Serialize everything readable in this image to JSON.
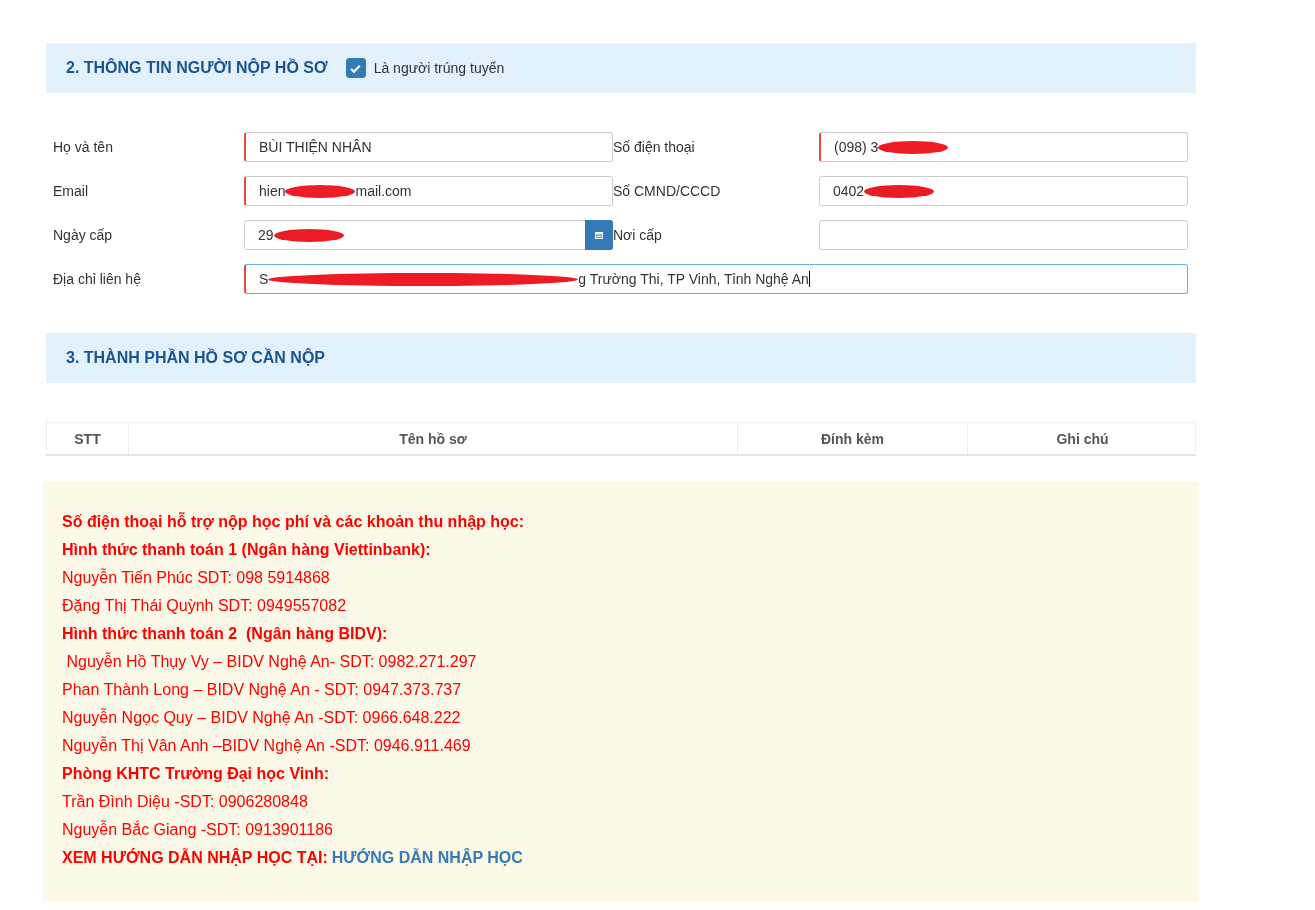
{
  "applicant_section": {
    "title": "2. THÔNG TIN NGƯỜI NỘP HỒ SƠ",
    "checkbox": {
      "label": "Là người trúng tuyển",
      "checked": true
    }
  },
  "fields": [
    {
      "label": "Họ và tên",
      "before": "BÙI THIỆN NHÂN",
      "redacted": false,
      "required": true,
      "focused": false,
      "kind": "text"
    },
    {
      "label": "Số điện thoại",
      "before": "(098) 3",
      "redacted": true,
      "required": true,
      "focused": false,
      "kind": "text"
    },
    {
      "label": "Email",
      "before": "hien",
      "redacted": true,
      "after": "mail.com",
      "required": true,
      "focused": false,
      "kind": "text"
    },
    {
      "label": "Số CMND/CCCD",
      "before": "0402",
      "redacted": true,
      "required": false,
      "focused": false,
      "kind": "text"
    },
    {
      "label": "Ngày cấp",
      "before": "29",
      "redacted": true,
      "required": false,
      "focused": false,
      "kind": "date"
    },
    {
      "label": "Nơi cấp",
      "redacted": false,
      "required": false,
      "focused": false,
      "kind": "text"
    },
    {
      "label": "Địa chỉ liên hệ",
      "before": "S",
      "redacted": true,
      "after": "g Trường Thi, TP Vinh, Tỉnh Nghệ An",
      "required": true,
      "focused": true,
      "kind": "wide"
    }
  ],
  "documents_section": {
    "title": "3. THÀNH PHẦN HỒ SƠ CẦN NỘP"
  },
  "table": {
    "columns": [
      "STT",
      "Tên hồ sơ",
      "Đính kèm",
      "Ghi chú"
    ]
  },
  "notice": [
    {
      "kind": "heading",
      "text": "Số điện thoại hỗ trợ nộp học phí và các khoản thu nhập học:"
    },
    {
      "kind": "heading",
      "text": "Hình thức thanh toán 1 (Ngân hàng Viettinbank):"
    },
    {
      "kind": "plain",
      "text": "Nguyễn Tiến Phúc SDT: 098 5914868"
    },
    {
      "kind": "plain",
      "text": "Đặng Thị Thái Quỳnh SDT: 0949557082"
    },
    {
      "kind": "heading",
      "text": "Hình thức thanh toán 2  (Ngân hàng BIDV):"
    },
    {
      "kind": "plain",
      "text": " Nguyễn Hồ Thụy Vy – BIDV Nghệ An- SDT: 0982.271.297"
    },
    {
      "kind": "plain",
      "text": "Phan Thành Long – BIDV Nghệ An - SDT: 0947.373.737"
    },
    {
      "kind": "plain",
      "text": "Nguyễn Ngọc Quy – BIDV Nghệ An -SDT: 0966.648.222"
    },
    {
      "kind": "plain",
      "text": "Nguyễn Thị Vân Anh –BIDV Nghệ An -SDT: 0946.911.469"
    },
    {
      "kind": "heading",
      "text": "Phòng KHTC Trường Đại học Vinh:"
    },
    {
      "kind": "plain",
      "text": "Trần Đình Diệu -SDT: 0906280848"
    },
    {
      "kind": "plain",
      "text": "Nguyễn Bắc Giang -SDT: 0913901186"
    },
    {
      "kind": "link_line",
      "text": "XEM HƯỚNG DẪN NHẬP HỌC TẠI:",
      "link": "HƯỚNG DẪN NHẬP HỌC"
    }
  ]
}
